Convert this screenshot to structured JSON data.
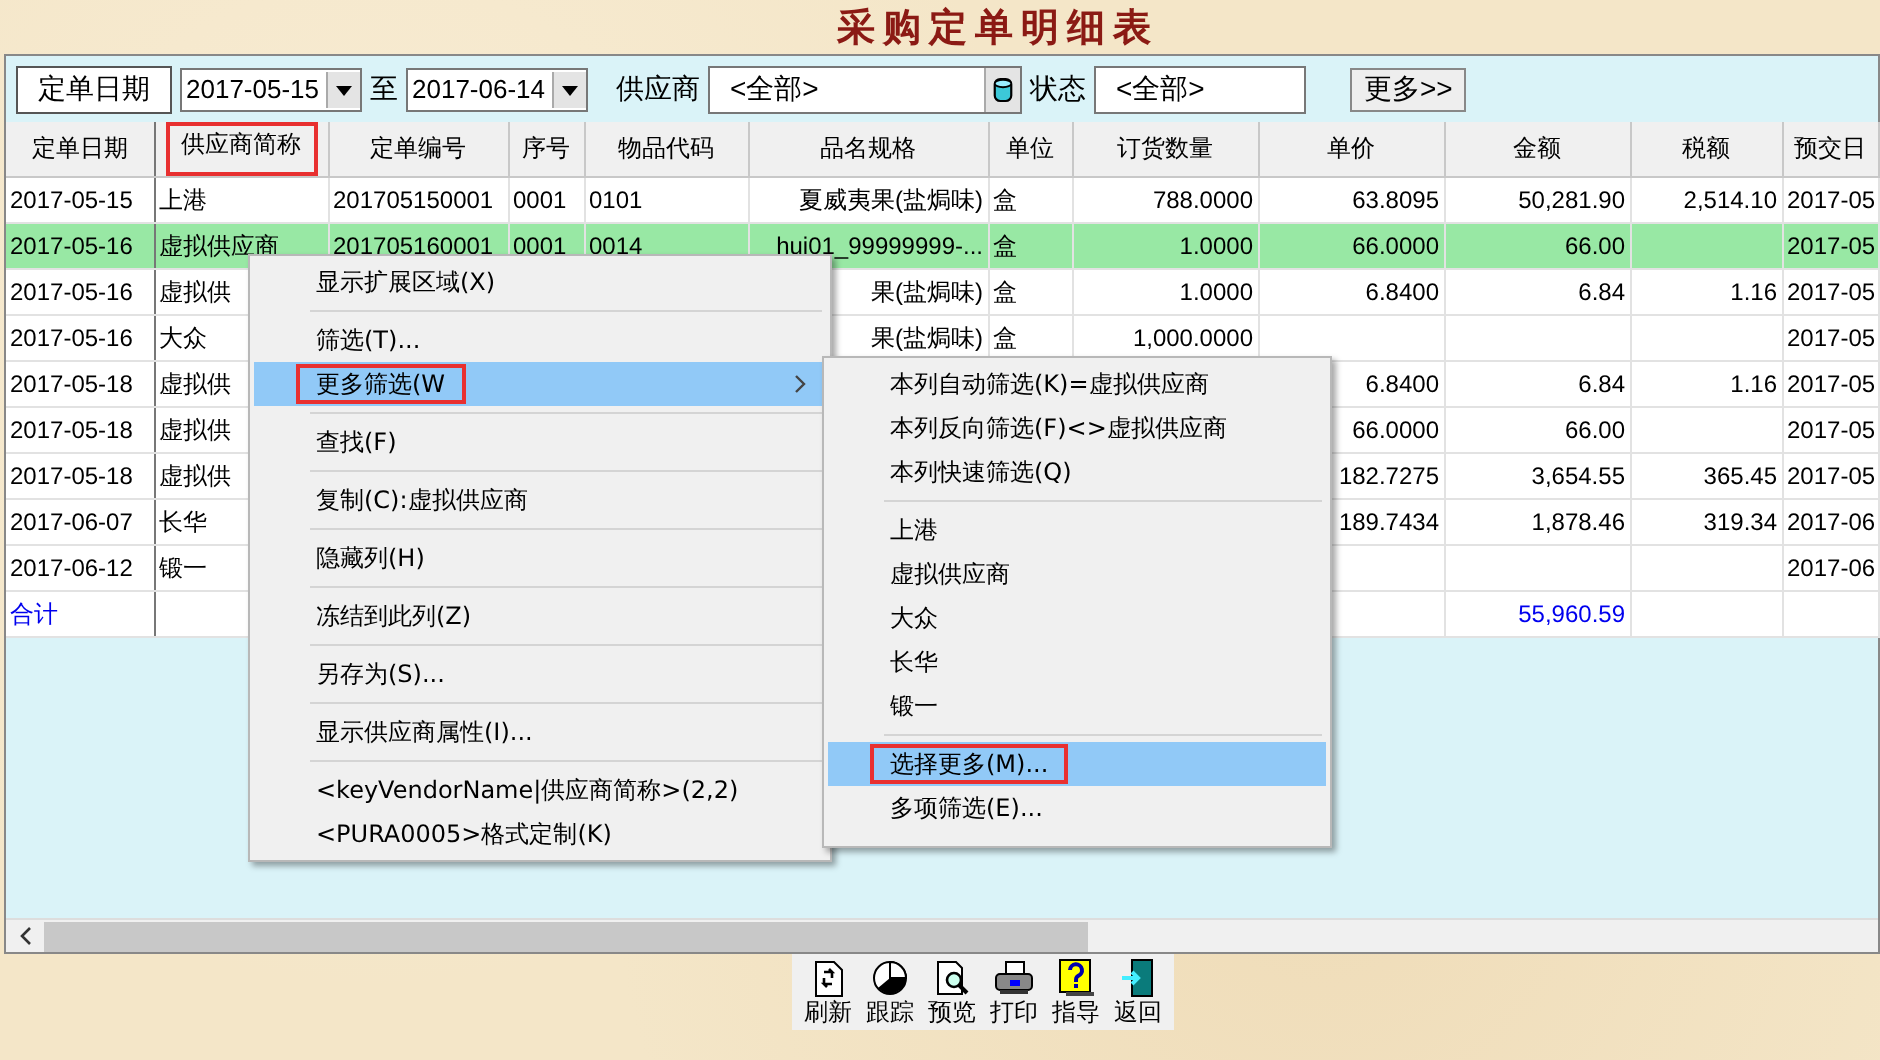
{
  "window": {
    "title": "采购定单明细表"
  },
  "filters": {
    "date_label": "定单日期",
    "date_from": "2017-05-15",
    "to_label": "至",
    "date_to": "2017-06-14",
    "supplier_label": "供应商",
    "supplier_value": "<全部>",
    "status_label": "状态",
    "status_value": "<全部>",
    "more_button": "更多>>"
  },
  "table": {
    "columns": [
      {
        "label": "定单日期",
        "marked": false
      },
      {
        "label": "供应商简称",
        "marked": true
      },
      {
        "label": "定单编号",
        "marked": false
      },
      {
        "label": "序号",
        "marked": false
      },
      {
        "label": "物品代码",
        "marked": false
      },
      {
        "label": "品名规格",
        "marked": false
      },
      {
        "label": "单位",
        "marked": false
      },
      {
        "label": "订货数量",
        "marked": false
      },
      {
        "label": "单价",
        "marked": false
      },
      {
        "label": "金额",
        "marked": false
      },
      {
        "label": "税额",
        "marked": false
      },
      {
        "label": "预交日",
        "marked": false
      }
    ],
    "rows": [
      {
        "selected": false,
        "cells": [
          "2017-05-15",
          "上港",
          "201705150001",
          "0001",
          "0101",
          "夏威夷果(盐焗味)",
          "盒",
          "788.0000",
          "63.8095",
          "50,281.90",
          "2,514.10",
          "2017-05"
        ]
      },
      {
        "selected": true,
        "cells": [
          "2017-05-16",
          "虚拟供应商",
          "201705160001",
          "0001",
          "0014",
          "hui01_99999999-...",
          "盒",
          "1.0000",
          "66.0000",
          "66.00",
          null,
          "2017-05"
        ]
      },
      {
        "selected": false,
        "cells": [
          "2017-05-16",
          "虚拟供",
          null,
          null,
          null,
          "果(盐焗味)",
          "盒",
          "1.0000",
          "6.8400",
          "6.84",
          "1.16",
          "2017-05"
        ]
      },
      {
        "selected": false,
        "cells": [
          "2017-05-16",
          "大众",
          null,
          null,
          null,
          "果(盐焗味)",
          "盒",
          "1,000.0000",
          null,
          null,
          null,
          "2017-05"
        ]
      },
      {
        "selected": false,
        "cells": [
          "2017-05-18",
          "虚拟供",
          null,
          null,
          null,
          null,
          null,
          null,
          "6.8400",
          "6.84",
          "1.16",
          "2017-05"
        ]
      },
      {
        "selected": false,
        "cells": [
          "2017-05-18",
          "虚拟供",
          null,
          null,
          null,
          null,
          null,
          null,
          "66.0000",
          "66.00",
          null,
          "2017-05"
        ]
      },
      {
        "selected": false,
        "cells": [
          "2017-05-18",
          "虚拟供",
          null,
          null,
          null,
          null,
          null,
          null,
          "182.7275",
          "3,654.55",
          "365.45",
          "2017-05"
        ]
      },
      {
        "selected": false,
        "cells": [
          "2017-06-07",
          "长华",
          null,
          null,
          null,
          null,
          null,
          null,
          "189.7434",
          "1,878.46",
          "319.34",
          "2017-06"
        ]
      },
      {
        "selected": false,
        "cells": [
          "2017-06-12",
          "锻一",
          null,
          null,
          null,
          null,
          null,
          null,
          null,
          null,
          null,
          "2017-06"
        ]
      }
    ],
    "total": {
      "cells": [
        "合计",
        null,
        null,
        null,
        null,
        null,
        null,
        null,
        null,
        "55,960.59",
        null,
        null
      ]
    }
  },
  "context_menu": {
    "items": [
      {
        "kind": "item",
        "label": "显示扩展区域(X)",
        "selected": false,
        "marked": false,
        "submenu": false
      },
      {
        "kind": "separator"
      },
      {
        "kind": "item",
        "label": "筛选(T)...",
        "selected": false,
        "marked": false,
        "submenu": false
      },
      {
        "kind": "item",
        "label": "更多筛选(W",
        "selected": true,
        "marked": true,
        "submenu": true
      },
      {
        "kind": "separator"
      },
      {
        "kind": "item",
        "label": "查找(F)",
        "selected": false,
        "marked": false,
        "submenu": false
      },
      {
        "kind": "separator"
      },
      {
        "kind": "item",
        "label": "复制(C):虚拟供应商",
        "selected": false,
        "marked": false,
        "submenu": false
      },
      {
        "kind": "separator"
      },
      {
        "kind": "item",
        "label": "隐藏列(H)",
        "selected": false,
        "marked": false,
        "submenu": false
      },
      {
        "kind": "separator"
      },
      {
        "kind": "item",
        "label": "冻结到此列(Z)",
        "selected": false,
        "marked": false,
        "submenu": false
      },
      {
        "kind": "separator"
      },
      {
        "kind": "item",
        "label": "另存为(S)...",
        "selected": false,
        "marked": false,
        "submenu": false
      },
      {
        "kind": "separator"
      },
      {
        "kind": "item",
        "label": "显示供应商属性(I)...",
        "selected": false,
        "marked": false,
        "submenu": false
      },
      {
        "kind": "separator"
      },
      {
        "kind": "item",
        "label": "<keyVendorName|供应商简称>(2,2)",
        "selected": false,
        "marked": false,
        "submenu": false
      },
      {
        "kind": "item",
        "label": "<PURA0005>格式定制(K)",
        "selected": false,
        "marked": false,
        "submenu": false
      }
    ]
  },
  "submenu": {
    "items": [
      {
        "kind": "item",
        "label": "本列自动筛选(K)=虚拟供应商",
        "selected": false,
        "marked": false
      },
      {
        "kind": "item",
        "label": "本列反向筛选(F)<>虚拟供应商",
        "selected": false,
        "marked": false
      },
      {
        "kind": "item",
        "label": "本列快速筛选(Q)",
        "selected": false,
        "marked": false
      },
      {
        "kind": "separator"
      },
      {
        "kind": "item",
        "label": "上港",
        "selected": false,
        "marked": false
      },
      {
        "kind": "item",
        "label": "虚拟供应商",
        "selected": false,
        "marked": false
      },
      {
        "kind": "item",
        "label": "大众",
        "selected": false,
        "marked": false
      },
      {
        "kind": "item",
        "label": "长华",
        "selected": false,
        "marked": false
      },
      {
        "kind": "item",
        "label": "锻一",
        "selected": false,
        "marked": false
      },
      {
        "kind": "separator"
      },
      {
        "kind": "item",
        "label": "选择更多(M)...",
        "selected": true,
        "marked": true
      },
      {
        "kind": "item",
        "label": "多项筛选(E)...",
        "selected": false,
        "marked": false
      }
    ]
  },
  "bottom_toolbar": [
    "刷新",
    "跟踪",
    "预览",
    "打印",
    "指导",
    "返回"
  ]
}
